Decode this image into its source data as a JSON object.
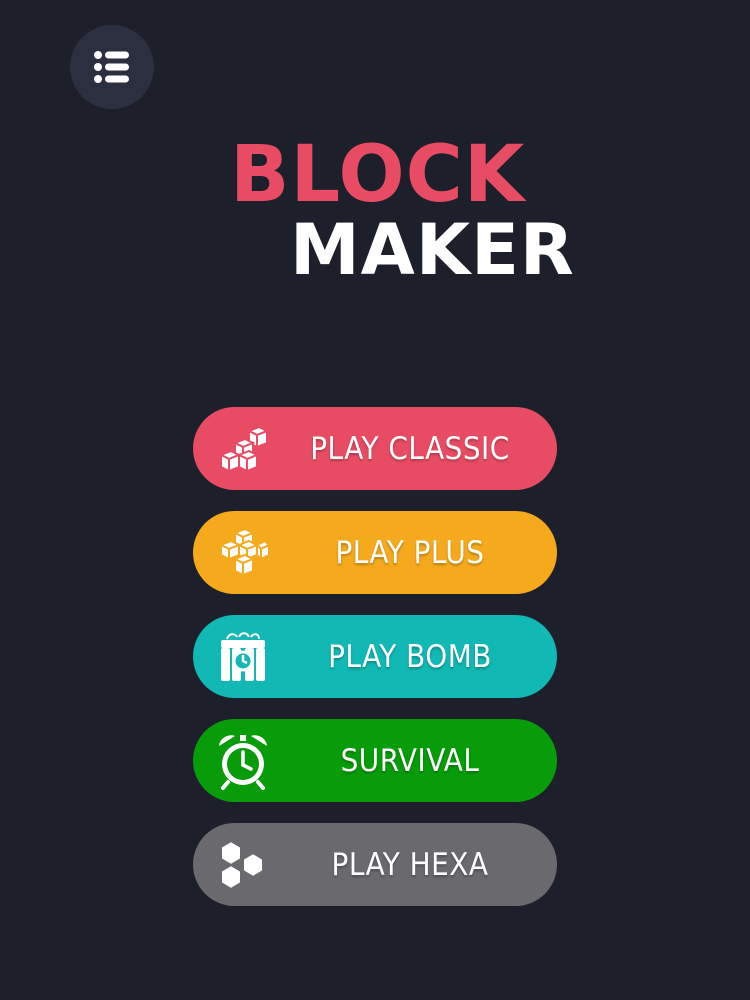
{
  "colors": {
    "background": "#1d1f2b",
    "title_block": "#e84c64",
    "title_maker": "#ffffff",
    "classic": "#e84c64",
    "plus": "#f5a91d",
    "bomb": "#11b8b4",
    "survival": "#089c0a",
    "hexa": "#6a6a6e"
  },
  "menu": {
    "icon": "list-icon"
  },
  "title": {
    "line1": "BLOCK",
    "line2": "MAKER"
  },
  "modes": [
    {
      "label": "PLAY CLASSIC",
      "icon": "blocks-stairs-icon",
      "color": "#e84c64"
    },
    {
      "label": "PLAY PLUS",
      "icon": "plus-blocks-icon",
      "color": "#f5a91d"
    },
    {
      "label": "PLAY BOMB",
      "icon": "bomb-icon",
      "color": "#11b8b4"
    },
    {
      "label": "SURVIVAL",
      "icon": "alarm-clock-icon",
      "color": "#089c0a"
    },
    {
      "label": "PLAY HEXA",
      "icon": "hexagons-icon",
      "color": "#6a6a6e"
    }
  ]
}
